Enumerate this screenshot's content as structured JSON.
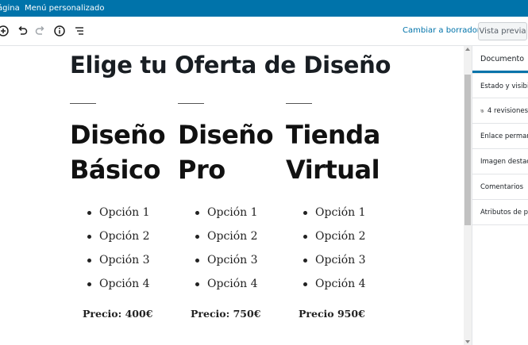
{
  "adminbar": {
    "page_label": "ágina",
    "custom_menu": "Menú personalizado"
  },
  "toolbar": {
    "icons": [
      "plus-circle-icon",
      "undo-icon",
      "redo-icon",
      "info-icon",
      "outline-icon"
    ],
    "switch_draft": "Cambiar a borrador",
    "preview": "Vista previa"
  },
  "page": {
    "title": "Elige tu Oferta de Diseño",
    "columns": [
      {
        "title_line1": "Diseño",
        "title_line2": "Básico",
        "options": [
          "Opción 1",
          "Opción 2",
          "Opción 3",
          "Opción 4"
        ],
        "price": "Precio: 400€"
      },
      {
        "title_line1": "Diseño",
        "title_line2": "Pro",
        "options": [
          "Opción 1",
          "Opción 2",
          "Opción 3",
          "Opción 4"
        ],
        "price": "Precio: 750€"
      },
      {
        "title_line1": "Tienda",
        "title_line2": "Virtual",
        "options": [
          "Opción 1",
          "Opción 2",
          "Opción 3",
          "Opción 4"
        ],
        "price": "Precio 950€"
      }
    ]
  },
  "sidebar": {
    "tab": "Documento",
    "status": "Estado y visibilidad",
    "revisions": "4 revisiones",
    "permalink": "Enlace permanente",
    "featured_image": "Imagen destacada",
    "comments": "Comentarios",
    "page_attributes": "Atributos de página"
  },
  "colors": {
    "admin_bar": "#0073aa",
    "accent": "#0073aa",
    "text": "#191e23"
  }
}
